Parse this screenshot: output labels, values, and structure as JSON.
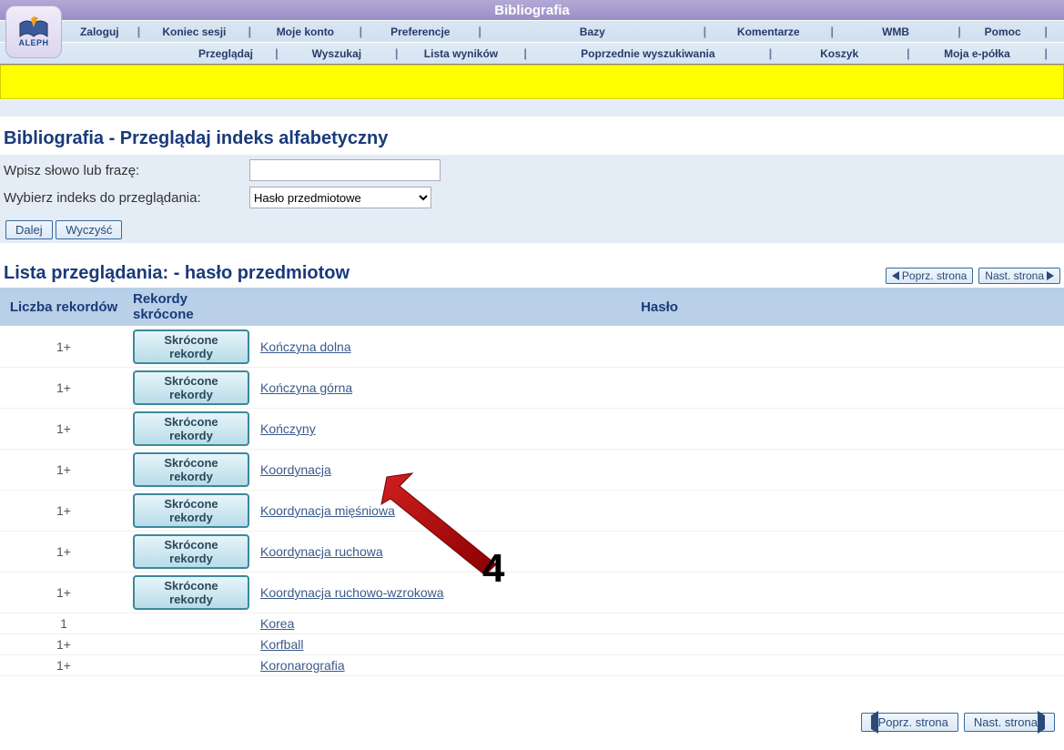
{
  "header": {
    "title": "Bibliografia",
    "logo_text": "ALEPH"
  },
  "menu": {
    "row1": [
      "Zaloguj",
      "Koniec sesji",
      "Moje konto",
      "Preferencje",
      "Bazy",
      "Komentarze",
      "WMB",
      "Pomoc"
    ],
    "row2": [
      "Przeglądaj",
      "Wyszukaj",
      "Lista wyników",
      "Poprzednie wyszukiwania",
      "Koszyk",
      "Moja e-półka"
    ]
  },
  "section1": {
    "title": "Bibliografia - Przeglądaj indeks alfabetyczny",
    "label_phrase": "Wpisz słowo lub frazę:",
    "label_index": "Wybierz indeks do przeglądania:",
    "select_option": "Hasło przedmiotowe",
    "btn_next": "Dalej",
    "btn_clear": "Wyczyść"
  },
  "browse": {
    "title": "Lista przeglądania: - hasło przedmiotow",
    "prev": "Poprz. strona",
    "next": "Nast. strona",
    "col1": "Liczba rekordów",
    "col2": "Rekordy skrócone",
    "col3": "Hasło",
    "short_label": "Skrócone rekordy",
    "rows": [
      {
        "count": "1+",
        "short": true,
        "label": "Kończyna dolna"
      },
      {
        "count": "1+",
        "short": true,
        "label": "Kończyna górna"
      },
      {
        "count": "1+",
        "short": true,
        "label": "Kończyny"
      },
      {
        "count": "1+",
        "short": true,
        "label": "Koordynacja"
      },
      {
        "count": "1+",
        "short": true,
        "label": "Koordynacja mięśniowa"
      },
      {
        "count": "1+",
        "short": true,
        "label": "Koordynacja ruchowa"
      },
      {
        "count": "1+",
        "short": true,
        "label": "Koordynacja ruchowo-wzrokowa"
      },
      {
        "count": "1",
        "short": false,
        "label": "Korea"
      },
      {
        "count": "1+",
        "short": false,
        "label": "Korfball"
      },
      {
        "count": "1+",
        "short": false,
        "label": "Koronarografia"
      }
    ]
  },
  "annotation": {
    "number": "4"
  }
}
